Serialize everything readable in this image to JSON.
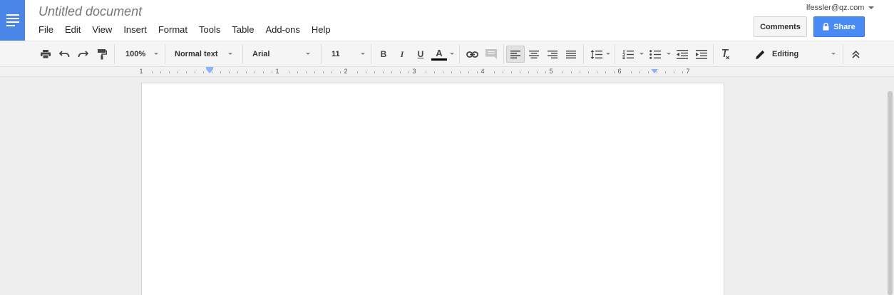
{
  "app": {
    "document_title": "Untitled document",
    "user_email": "lfessler@qz.com"
  },
  "menu": [
    "File",
    "Edit",
    "View",
    "Insert",
    "Format",
    "Tools",
    "Table",
    "Add-ons",
    "Help"
  ],
  "header_buttons": {
    "comments_label": "Comments",
    "share_label": "Share"
  },
  "toolbar": {
    "zoom": "100%",
    "style": "Normal text",
    "font": "Arial",
    "font_size": "11",
    "bold_label": "B",
    "italic_label": "I",
    "underline_label": "U",
    "text_color_label": "A",
    "mode": "Editing",
    "text_color": "#000000"
  },
  "ruler": {
    "numbers": [
      "1",
      "1",
      "2",
      "3",
      "4",
      "5",
      "6",
      "7"
    ]
  },
  "colors": {
    "brand": "#4a86e8",
    "share_button": "#4a8af4"
  }
}
